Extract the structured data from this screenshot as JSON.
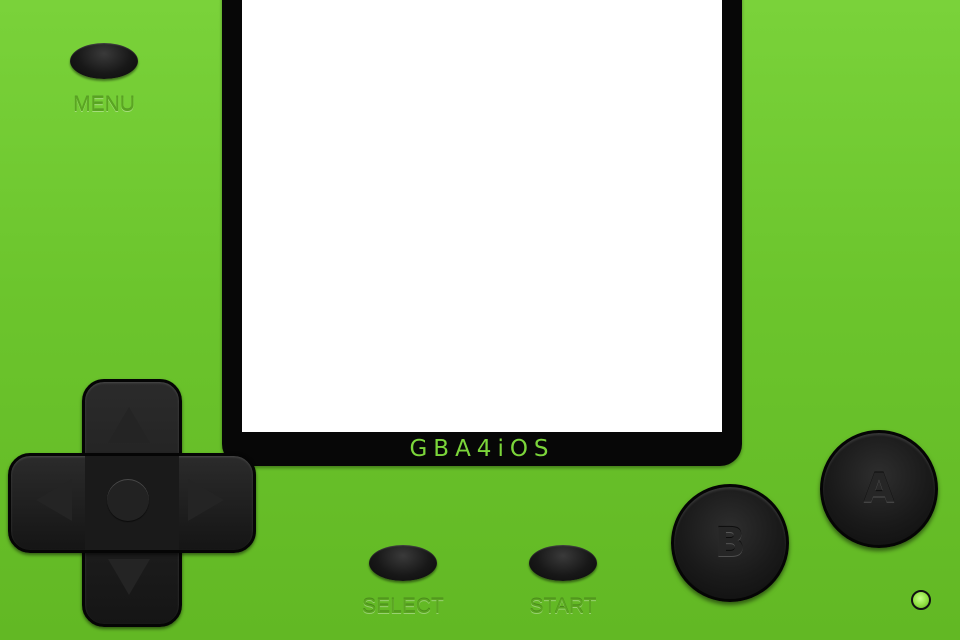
{
  "screen": {
    "logo": "GBA4iOS"
  },
  "buttons": {
    "menu_label": "MENU",
    "select_label": "SELECT",
    "start_label": "START",
    "a_label": "A",
    "b_label": "B"
  },
  "colors": {
    "body": "#6cc52d",
    "logo": "#7bd53a",
    "label": "#5aa621",
    "button": "#1a1a1a",
    "screen": "#ffffff",
    "led": "#8fe040"
  },
  "icons": {
    "dpad_up": "triangle-up-icon",
    "dpad_down": "triangle-down-icon",
    "dpad_left": "triangle-left-icon",
    "dpad_right": "triangle-right-icon",
    "dpad_center": "circle-icon"
  }
}
